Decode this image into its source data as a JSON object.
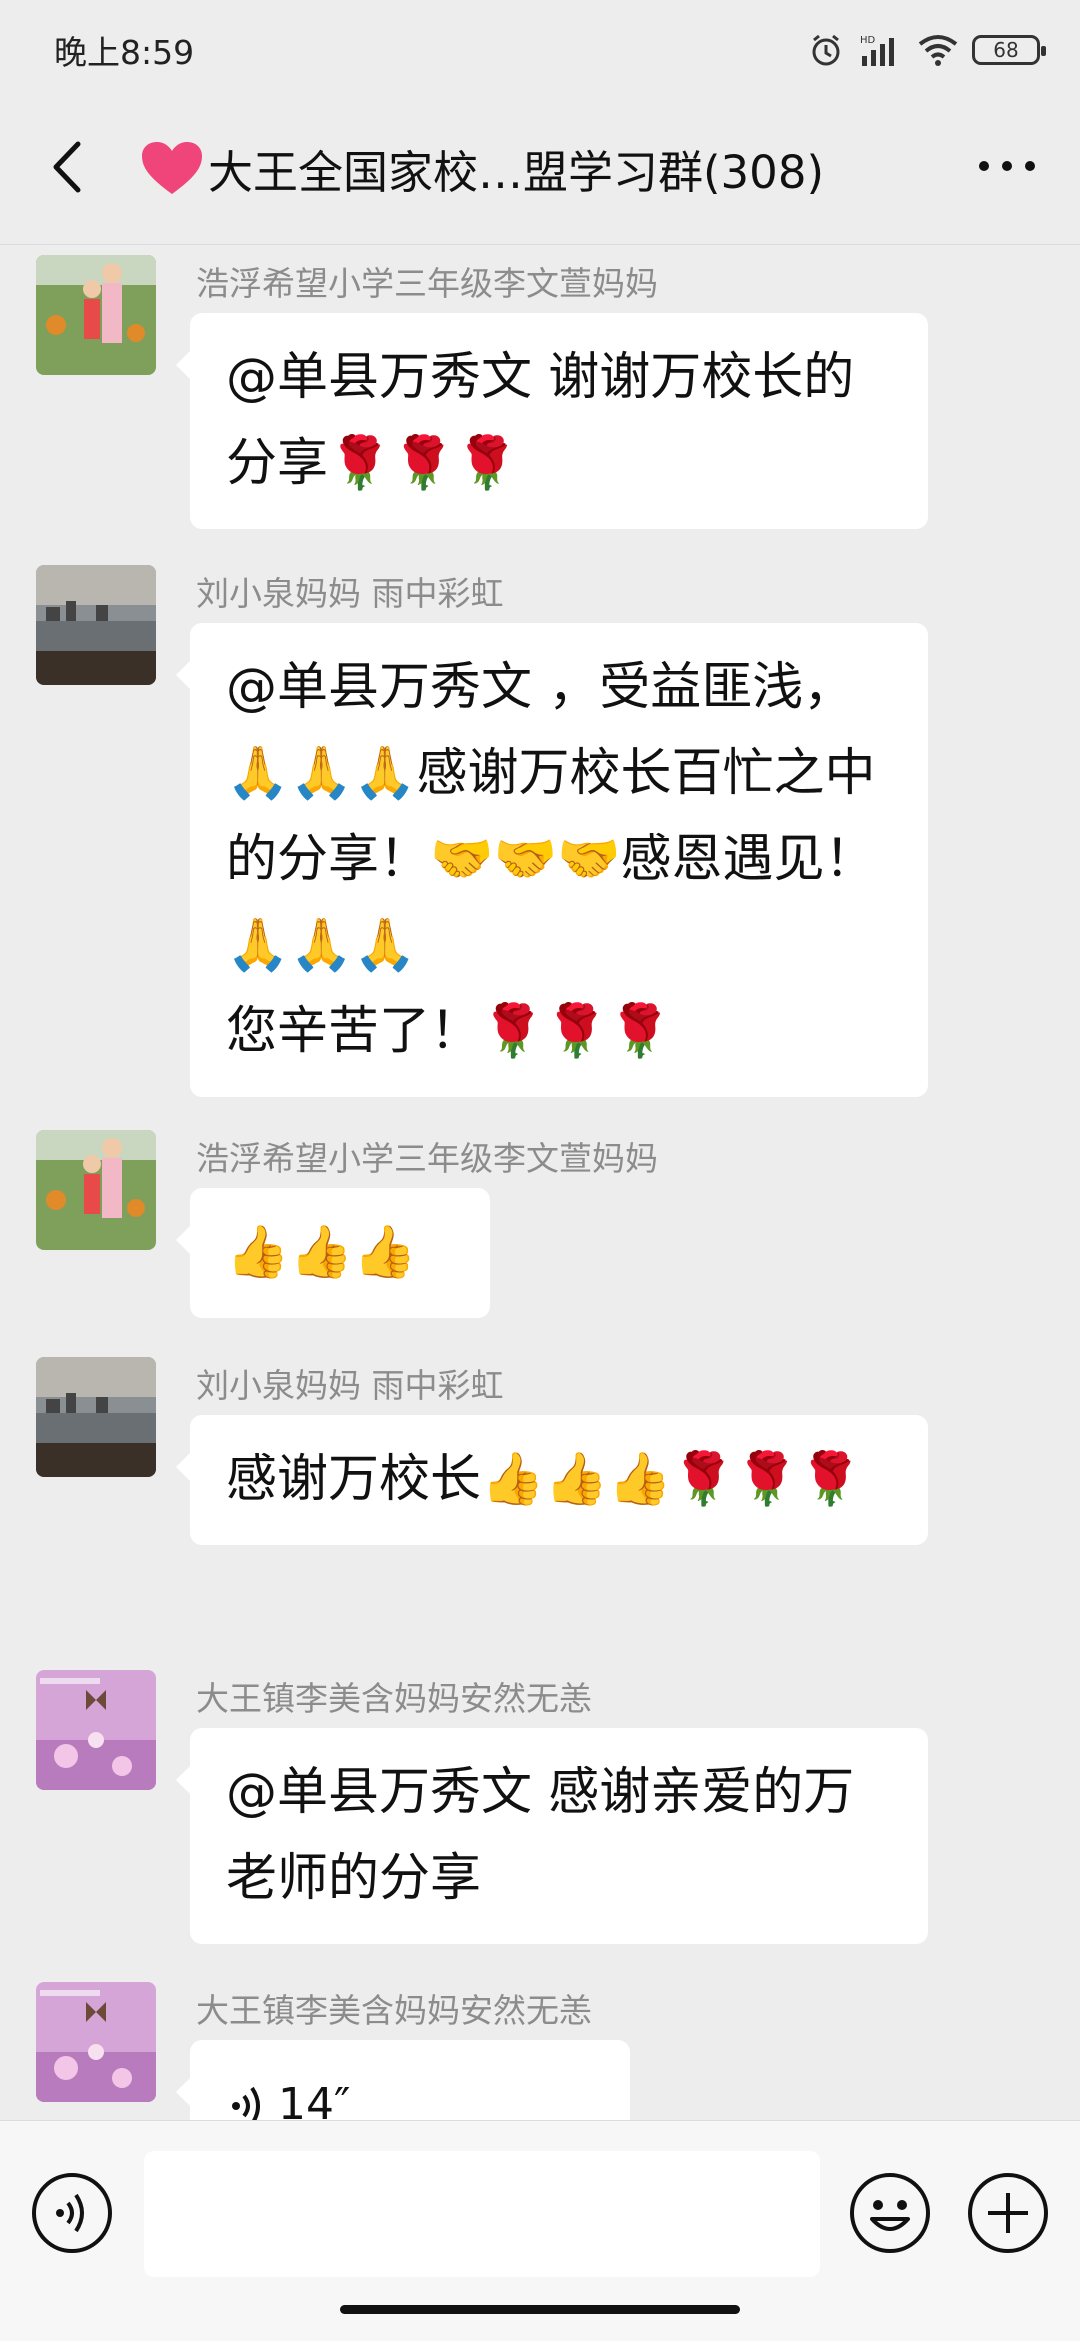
{
  "status": {
    "time": "晚上8:59",
    "battery": "68",
    "network": "HD"
  },
  "header": {
    "title": "大王全国家校…盟学习群(308)"
  },
  "messages": [
    {
      "sender": "浩浮希望小学三年级李文萱妈妈",
      "text": "@单县万秀文  谢谢万校长的分享🌹🌹🌹"
    },
    {
      "sender": "刘小泉妈妈  雨中彩虹",
      "text": "@单县万秀文 ，受益匪浅，🙏🙏🙏感谢万校长百忙之中的分享！🤝🤝🤝感恩遇见！🙏🙏🙏\n您辛苦了！🌹🌹🌹"
    },
    {
      "sender": "浩浮希望小学三年级李文萱妈妈",
      "text": "👍👍👍"
    },
    {
      "sender": "刘小泉妈妈  雨中彩虹",
      "text": "感谢万校长👍👍👍🌹🌹🌹"
    },
    {
      "sender": "大王镇李美含妈妈安然无恙",
      "text": "@单县万秀文  感谢亲爱的万老师的分享"
    },
    {
      "sender": "大王镇李美含妈妈安然无恙",
      "voice_duration": "14″"
    }
  ],
  "icons": {
    "back": "back-arrow-icon",
    "more": "more-dots-icon",
    "voice": "voice-input-icon",
    "emoji": "emoji-icon",
    "plus": "plus-icon"
  }
}
